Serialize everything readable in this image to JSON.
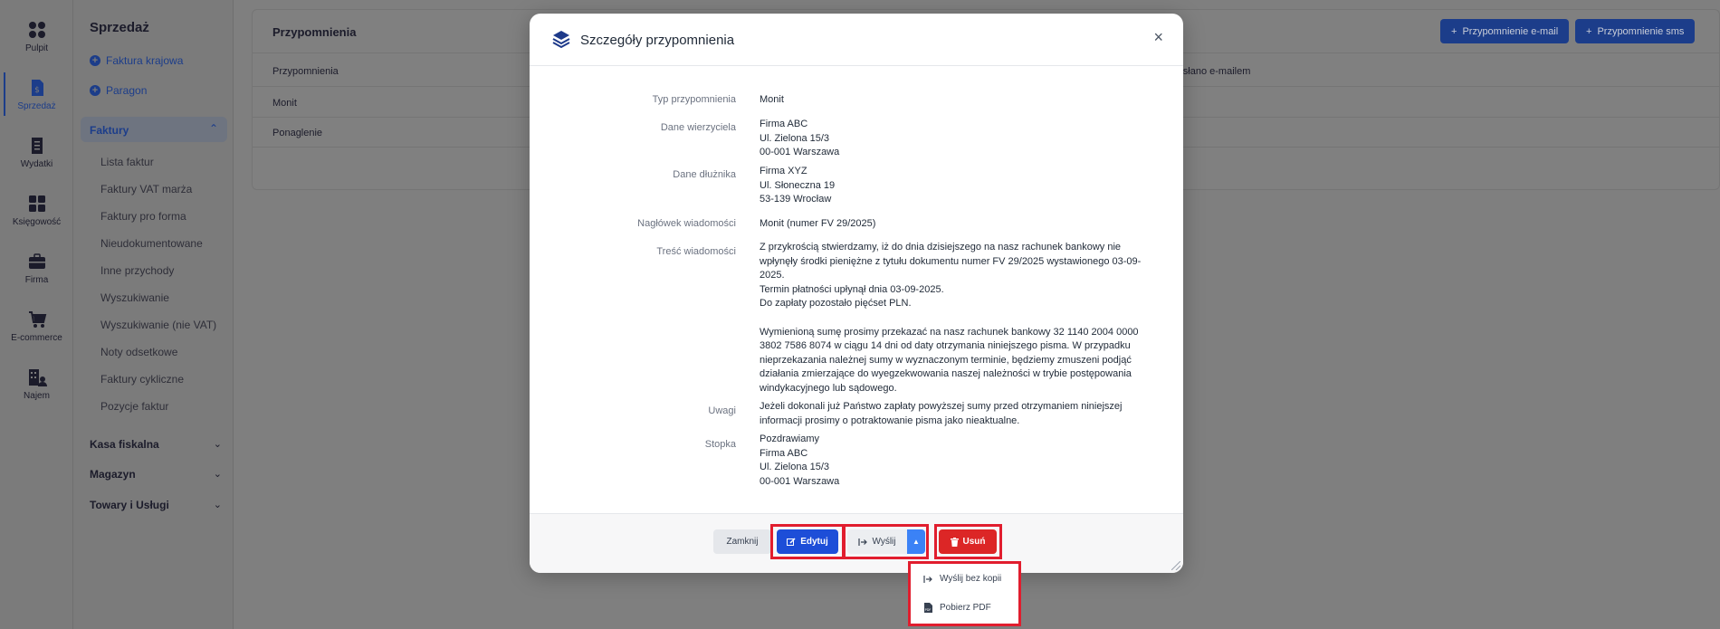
{
  "rail": {
    "items": [
      {
        "label": "Pulpit",
        "icon": "dashboard-icon"
      },
      {
        "label": "Sprzedaż",
        "icon": "sales-document-icon",
        "active": true
      },
      {
        "label": "Wydatki",
        "icon": "expenses-document-icon"
      },
      {
        "label": "Księgowość",
        "icon": "accounting-grid-icon"
      },
      {
        "label": "Firma",
        "icon": "briefcase-icon"
      },
      {
        "label": "E-commerce",
        "icon": "cart-icon"
      },
      {
        "label": "Najem",
        "icon": "rental-icon"
      }
    ]
  },
  "menu": {
    "title": "Sprzedaż",
    "quick": [
      "Faktura krajowa",
      "Paragon"
    ],
    "open_group": "Faktury",
    "sub_items": [
      "Lista faktur",
      "Faktury VAT marża",
      "Faktury pro forma",
      "Nieudokumentowane",
      "Inne przychody",
      "Wyszukiwanie",
      "Wyszukiwanie (nie VAT)",
      "Noty odsetkowe",
      "Faktury cykliczne",
      "Pozycje faktur"
    ],
    "groups": [
      "Kasa fiskalna",
      "Magazyn",
      "Towary i Usługi"
    ]
  },
  "panel": {
    "title": "Przypomnienia",
    "btn_email": "Przypomnienie e-mail",
    "btn_sms": "Przypomnienie sms",
    "col_1": "Przypomnienia",
    "col_2": "Wysłano e-mailem",
    "rows": [
      "Monit",
      "Ponaglenie"
    ]
  },
  "modal": {
    "title": "Szczegóły przypomnienia",
    "fields": {
      "type_label": "Typ przypomnienia",
      "type_value": "Monit",
      "creditor_label": "Dane wierzyciela",
      "creditor_lines": [
        "Firma ABC",
        "Ul. Zielona 15/3",
        "00-001 Warszawa"
      ],
      "debtor_label": "Dane dłużnika",
      "debtor_lines": [
        "Firma XYZ",
        "Ul. Słoneczna 19",
        "53-139 Wrocław"
      ],
      "header_label": "Nagłówek wiadomości",
      "header_value": "Monit (numer FV 29/2025)",
      "body_label": "Treść wiadomości",
      "body_p1": "Z przykrością stwierdzamy, iż do dnia dzisiejszego na nasz rachunek bankowy nie wpłynęły środki pieniężne z tytułu dokumentu numer FV 29/2025 wystawionego 03-09-2025.",
      "body_p2": "Termin płatności upłynął dnia 03-09-2025.",
      "body_p3": "Do zapłaty pozostało pięćset PLN.",
      "body_p4": "Wymienioną sumę prosimy przekazać na nasz rachunek bankowy 32 1140 2004 0000 3802 7586 8074 w ciągu 14 dni od daty otrzymania niniejszego pisma. W przypadku nieprzekazania należnej sumy w wyznaczonym terminie, będziemy zmuszeni podjąć działania zmierzające do wyegzekwowania naszej należności w trybie postępowania windykacyjnego lub sądowego.",
      "notes_label": "Uwagi",
      "notes_value": "Jeżeli dokonali już Państwo zapłaty powyższej sumy przed otrzymaniem niniejszej informacji prosimy o potraktowanie pisma jako nieaktualne.",
      "footer_label": "Stopka",
      "footer_lines": [
        "Pozdrawiamy",
        "Firma ABC",
        "Ul. Zielona 15/3",
        "00-001 Warszawa"
      ]
    },
    "buttons": {
      "close": "Zamknij",
      "edit": "Edytuj",
      "send": "Wyślij",
      "delete": "Usuń"
    },
    "dropdown": [
      "Wyślij bez kopii",
      "Pobierz PDF"
    ]
  },
  "colors": {
    "primary": "#1d4ed8",
    "danger": "#dc2626",
    "highlight": "#e11d2e",
    "caret": "#3b82f6"
  }
}
